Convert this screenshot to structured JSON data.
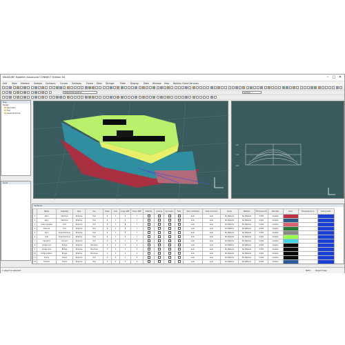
{
  "app": {
    "title": "MAXSURF Modeler Advanced CONNECT Edition 64",
    "win_min": "–",
    "win_max": "□",
    "win_close": "✕"
  },
  "menu": [
    "Edit",
    "View",
    "Markers",
    "Sample",
    "Contours",
    "Curves",
    "Surfaces",
    "Frame",
    "Deck",
    "Stringer",
    "Plate",
    "Display",
    "Data",
    "Window",
    "Help",
    "Bentley Cloud Services"
  ],
  "toolbar": {
    "combo1": "Default Perspective",
    "combo2": "Surface"
  },
  "tree": {
    "title": "Tree",
    "items": [
      "Design",
      "Geometry",
      "Hull",
      "Superstructure"
    ]
  },
  "tree2": {
    "title": "Grids"
  },
  "views": {
    "perspective": "Perspective",
    "body": "Body Plan"
  },
  "grid": {
    "tab": "Surfaces",
    "columns": [
      "",
      "Name",
      "Assembly",
      "Type",
      "Use",
      "Rows",
      "Cols",
      "Long. Stiff.",
      "Trans. Stiff.",
      "Visibility",
      "Locking",
      "Symmetry",
      "Split",
      "Para. Grid Rows",
      "Para. Grid Cols",
      "Group",
      "Material",
      "Thickness mm",
      "Direction",
      "Color",
      "Transparency %",
      "Coding Surfs"
    ],
    "rows": [
      {
        "n": "1",
        "name": "stern",
        "asm": "Stemhull",
        "type": "B-Spline",
        "use": "Hull",
        "rows": "8",
        "cols": "7",
        "ls": "8",
        "ts": "7",
        "pr": "auto",
        "pc": "auto",
        "grp": "No Material",
        "mat": "No Material",
        "th": "0.000",
        "dir": "Outside",
        "color": "#c03040"
      },
      {
        "n": "2",
        "name": "stern",
        "asm": "Stemhull",
        "type": "B-Spline",
        "use": "Hull",
        "rows": "8",
        "cols": "7",
        "ls": "8",
        "ts": "7",
        "pr": "auto",
        "pc": "auto",
        "grp": "No Material",
        "mat": "No Material",
        "th": "0.000",
        "dir": "Outside",
        "color": "#305a8c"
      },
      {
        "n": "3",
        "name": "outer topsides",
        "asm": "Hull",
        "type": "B-Spline",
        "use": "Hull",
        "rows": "8",
        "cols": "7",
        "ls": "8",
        "ts": "7",
        "pr": "auto",
        "pc": "auto",
        "grp": "No Material",
        "mat": "No Material",
        "th": "0.000",
        "dir": "Outside",
        "color": "#d86070"
      },
      {
        "n": "4",
        "name": "keel rail",
        "asm": "Hull",
        "type": "B-Spline",
        "use": "Hull",
        "rows": "8",
        "cols": "7",
        "ls": "8",
        "ts": "7",
        "pr": "auto",
        "pc": "auto",
        "grp": "No Material",
        "mat": "No Material",
        "th": "0.000",
        "dir": "Outside",
        "color": "#2a7c3a"
      },
      {
        "n": "5",
        "name": "stern",
        "asm": "Superstructure",
        "type": "B-Spline",
        "use": "Hull",
        "rows": "8",
        "cols": "7",
        "ls": "8",
        "ts": "7",
        "pr": "auto",
        "pc": "auto",
        "grp": "No Material",
        "mat": "No Material",
        "th": "0.000",
        "dir": "Outside",
        "color": "#8a8a8a"
      },
      {
        "n": "6",
        "name": "side",
        "asm": "Superstructure",
        "type": "B-Spline",
        "use": "Hull",
        "rows": "8",
        "cols": "7",
        "ls": "8",
        "ts": "7",
        "pr": "auto",
        "pc": "auto",
        "grp": "No Material",
        "mat": "No Material",
        "th": "0.000",
        "dir": "Outside",
        "color": "#9aff4a"
      },
      {
        "n": "7",
        "name": "transom1",
        "asm": "Transom",
        "type": "B-Spline",
        "use": "Hull",
        "rows": "3",
        "cols": "3",
        "ls": "3",
        "ts": "3",
        "pr": "auto",
        "pc": "auto",
        "grp": "No Material",
        "mat": "No Material",
        "th": "0.000",
        "dir": "Outside",
        "color": "#40d8e8"
      },
      {
        "n": "8",
        "name": "bridge roof",
        "asm": "Bridge",
        "type": "B-Spline",
        "use": "Structure",
        "rows": "3",
        "cols": "3",
        "ls": "3",
        "ts": "3",
        "pr": "auto",
        "pc": "auto",
        "grp": "No Material",
        "mat": "No Material",
        "th": "0.000",
        "dir": "Outside",
        "color": "#0a0a0a"
      },
      {
        "n": "9",
        "name": "bridge side",
        "asm": "Bridge",
        "type": "B-Spline",
        "use": "Structure",
        "rows": "3",
        "cols": "3",
        "ls": "3",
        "ts": "3",
        "pr": "auto",
        "pc": "auto",
        "grp": "No Material",
        "mat": "No Material",
        "th": "0.000",
        "dir": "Outside",
        "color": "#0a0a0a"
      },
      {
        "n": "10",
        "name": "bridge bottom",
        "asm": "Bridge",
        "type": "B-Spline",
        "use": "Structure",
        "rows": "3",
        "cols": "3",
        "ls": "3",
        "ts": "3",
        "pr": "auto",
        "pc": "auto",
        "grp": "No Material",
        "mat": "No Material",
        "th": "0.000",
        "dir": "Outside",
        "color": "#0a0a0a"
      },
      {
        "n": "11",
        "name": "Frame",
        "asm": "Frame",
        "type": "B-Spline",
        "use": "Hull",
        "rows": "3",
        "cols": "3",
        "ls": "3",
        "ts": "3",
        "pr": "auto",
        "pc": "auto",
        "grp": "No Material",
        "mat": "No Material",
        "th": "0.000",
        "dir": "Outside",
        "color": "#0a0a0a"
      },
      {
        "n": "12",
        "name": "Frame2",
        "asm": "Frame",
        "type": "B-Spline",
        "use": "Hull",
        "rows": "3",
        "cols": "3",
        "ls": "3",
        "ts": "3",
        "pr": "auto",
        "pc": "auto",
        "grp": "No Material",
        "mat": "No Material",
        "th": "0.000",
        "dir": "Outside",
        "color": "#2a5a9a"
      },
      {
        "n": "13",
        "name": "transom",
        "asm": "Transom",
        "type": "B-Spline",
        "use": "Hull",
        "rows": "3",
        "cols": "3",
        "ls": "3",
        "ts": "3",
        "pr": "auto",
        "pc": "auto",
        "grp": "No Material",
        "mat": "No Material",
        "th": "0.000",
        "dir": "Outside",
        "color": "#e8e8e8"
      },
      {
        "n": "14",
        "name": "transom2",
        "asm": "Transom",
        "type": "B-Spline",
        "use": "Hull",
        "rows": "3",
        "cols": "3",
        "ls": "3",
        "ts": "3",
        "pr": "auto",
        "pc": "auto",
        "grp": "No Material",
        "mat": "No Material",
        "th": "0.000",
        "dir": "Outside",
        "color": "#8fb0ff"
      }
    ]
  },
  "status": {
    "left": "1 object is selected",
    "right1": "NUM",
    "right2": "Object Snap"
  }
}
